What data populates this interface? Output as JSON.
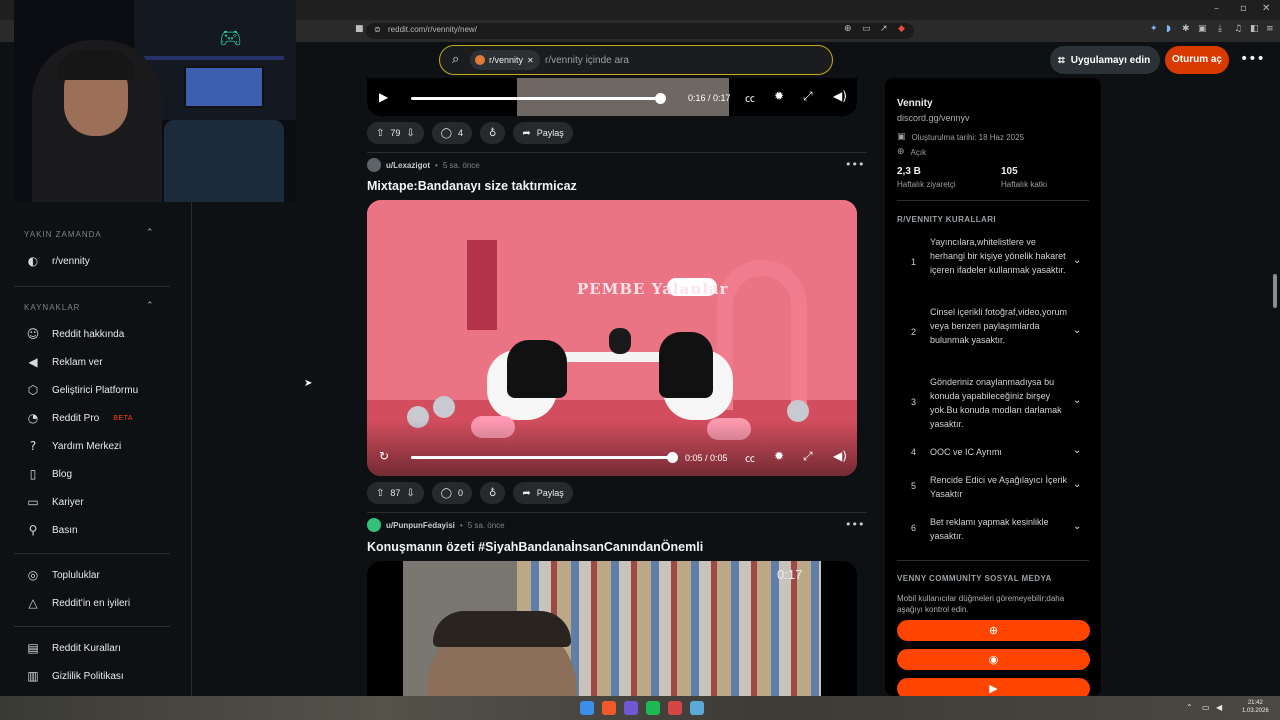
{
  "browser": {
    "url": "reddit.com/r/vennity/new/"
  },
  "header": {
    "search_chip": "r/vennity",
    "search_placeholder": "r/vennity içinde ara",
    "app_button": "Uygulamayı edin",
    "login_button": "Oturum aç"
  },
  "sidebar": {
    "recent_heading": "YAKIN ZAMANDA",
    "recent_items": [
      {
        "label": "r/vennity"
      }
    ],
    "resources_heading": "KAYNAKLAR",
    "resources": [
      {
        "label": "Reddit hakkında",
        "icon": "reddit-icon"
      },
      {
        "label": "Reklam ver",
        "icon": "megaphone-icon"
      },
      {
        "label": "Geliştirici Platformu",
        "icon": "developer-icon"
      },
      {
        "label": "Reddit Pro",
        "icon": "pro-icon",
        "badge": "BETA"
      },
      {
        "label": "Yardım Merkezi",
        "icon": "help-icon"
      },
      {
        "label": "Blog",
        "icon": "book-icon"
      },
      {
        "label": "Kariyer",
        "icon": "briefcase-icon"
      },
      {
        "label": "Basın",
        "icon": "microphone-icon"
      }
    ],
    "community_links": [
      {
        "label": "Topluluklar",
        "icon": "communities-icon"
      },
      {
        "label": "Reddit'in en iyileri",
        "icon": "best-of-icon"
      }
    ],
    "policy_links": [
      {
        "label": "Reddit Kuralları",
        "icon": "rules-icon"
      },
      {
        "label": "Gizlilik Politikası",
        "icon": "privacy-icon"
      }
    ]
  },
  "feed": {
    "post1": {
      "time": "0:16 / 0:17",
      "progress": 1.0,
      "votes": "79",
      "comments": "4",
      "share": "Paylaş"
    },
    "post2": {
      "user": "u/Lexazigot",
      "age": "5 sa. önce",
      "title": "Mixtape:Bandanayı size taktırmicaz",
      "video_sign": "PEMBE Yalanlar",
      "time": "0:05 / 0:05",
      "progress": 1.0,
      "votes": "87",
      "comments": "0",
      "share": "Paylaş"
    },
    "post3": {
      "user": "u/PunpunFedayisi",
      "age": "5 sa. önce",
      "title": "Konuşmanın özeti #SiyahBandanaİnsanCanındanÖnemli",
      "video_time": "0:17"
    }
  },
  "community": {
    "name": "Vennity",
    "link": "discord.gg/vennyv",
    "created": "Oluşturulma tarihi: 18 Haz 2025",
    "visibility": "Açık",
    "weekly_visitors": "2,3 B",
    "weekly_visitors_label": "Haftalık ziyaretçi",
    "weekly_contributions": "105",
    "weekly_contributions_label": "Haftalık katkı",
    "rules_heading": "R/VENNITY KURALLARI",
    "rules": [
      {
        "num": "1",
        "text": "Yayıncılara,whitelistlere ve herhangi bir kişiye yönelik hakaret içeren ifadeler kullanmak yasaktır."
      },
      {
        "num": "2",
        "text": "Cinsel içerikli fotoğraf,video,yorum veya benzeri paylaşımlarda bulunmak yasaktır."
      },
      {
        "num": "3",
        "text": "Gönderiniz onaylanmadıysa bu konuda yapabileceğiniz birşey yok.Bu konuda modları darlamak yasaktır."
      },
      {
        "num": "4",
        "text": "OOC ve IC Ayrımı"
      },
      {
        "num": "5",
        "text": "Rencide Edici ve Aşağılayıcı İçerik Yasaktır"
      },
      {
        "num": "6",
        "text": "Bet reklamı yapmak kesinlikle yasaktır."
      }
    ],
    "social_heading": "VENNY COMMUNİTY SOSYAL MEDYA",
    "social_note": "Mobil kullanıcılar düğmeleri göremeyebilir;daha aşağıyı kontrol edin.",
    "social_buttons": [
      {
        "icon": "globe-icon",
        "glyph": "⊕"
      },
      {
        "icon": "discord-icon",
        "glyph": "◉"
      },
      {
        "icon": "youtube-icon",
        "glyph": "▶"
      }
    ]
  },
  "taskbar": {
    "time": "21:42",
    "date": "1.03.2026"
  },
  "colors": {
    "accent": "#ff4500",
    "login": "#d93a00",
    "search_border": "#c7a81c",
    "background": "#0e1113"
  }
}
